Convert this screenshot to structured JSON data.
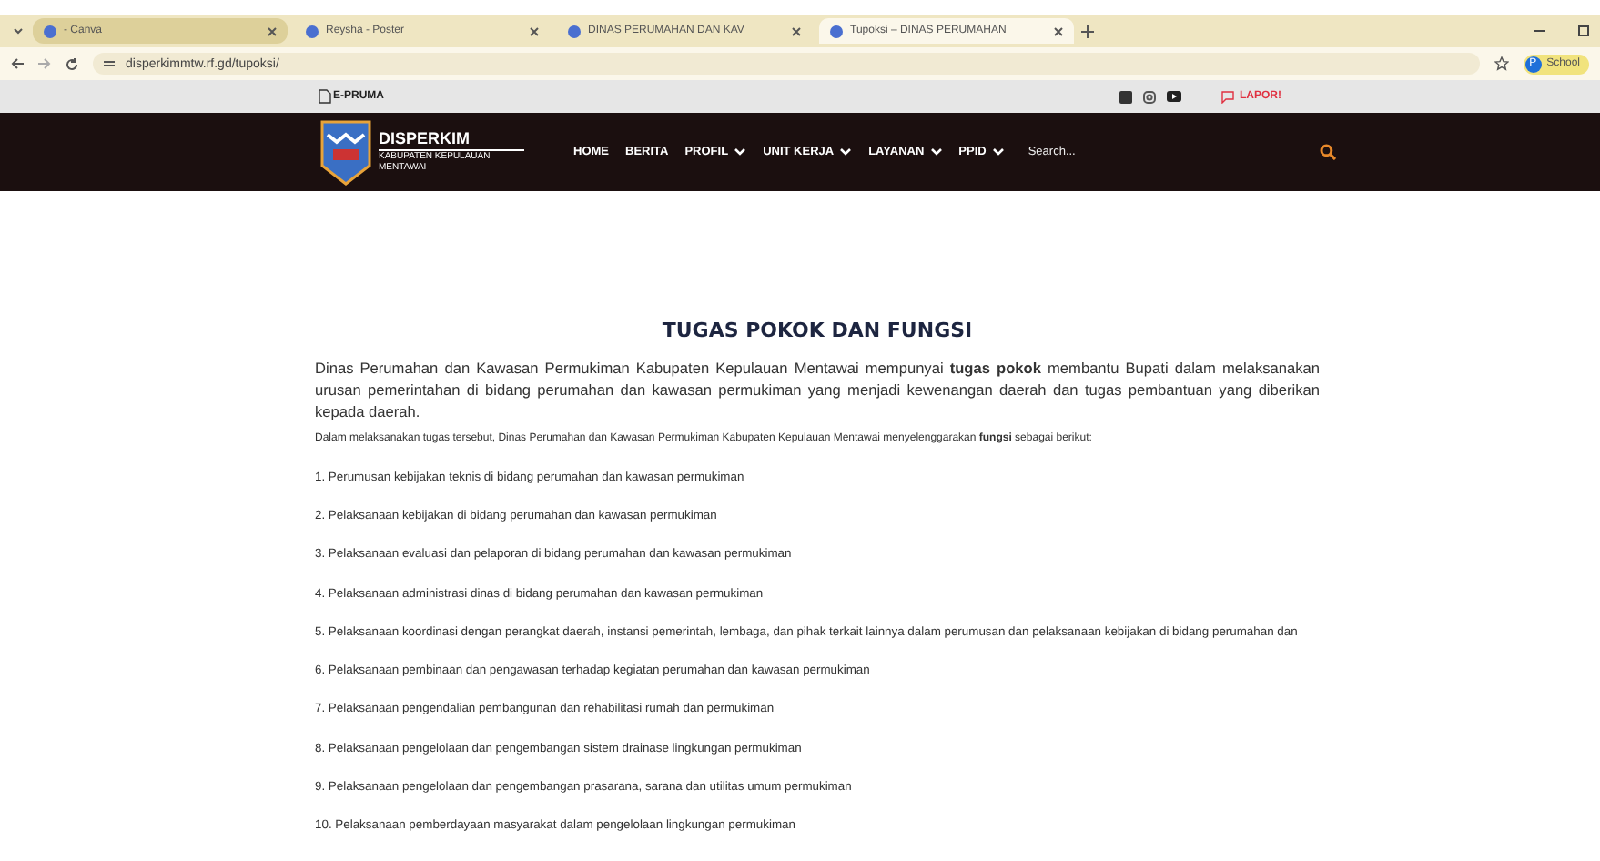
{
  "browser": {
    "tabs": [
      {
        "label": "- Canva",
        "selected": false,
        "hovered": true
      },
      {
        "label": "Reysha - Poster",
        "selected": false,
        "hovered": false
      },
      {
        "label": "DINAS PERUMAHAN DAN KAV",
        "selected": false,
        "hovered": false
      },
      {
        "label": "Tupoksi – DINAS PERUMAHAN",
        "selected": true,
        "hovered": false
      }
    ],
    "url": "disperkimmtw.rf.gd/tupoksi/",
    "profile": {
      "initial": "P",
      "label": "School"
    }
  },
  "topbar": {
    "brand": "E-PRUMA",
    "report": "LAPOR!"
  },
  "nav": {
    "logo_title": "DISPERKIM",
    "logo_subtitle": "KABUPATEN KEPULAUAN MENTAWAI",
    "items": [
      {
        "label": "HOME",
        "dropdown": false
      },
      {
        "label": "BERITA",
        "dropdown": false
      },
      {
        "label": "PROFIL",
        "dropdown": true
      },
      {
        "label": "UNIT KERJA",
        "dropdown": true
      },
      {
        "label": "LAYANAN",
        "dropdown": true
      },
      {
        "label": "PPID",
        "dropdown": true
      }
    ],
    "search": {
      "placeholder": "Search..."
    }
  },
  "content": {
    "title": "TUGAS POKOK DAN FUNGSI",
    "intro": "Dinas Perumahan dan Kawasan Permukiman Kabupaten Kepulauan Mentawai mempunyai **tugas pokok** membantu Bupati dalam melaksanakan urusan pemerintahan di bidang perumahan dan kawasan permukiman yang menjadi kewenangan daerah dan tugas pembantuan yang diberikan kepada daerah.",
    "lead": "Dalam melaksanakan tugas tersebut, Dinas Perumahan dan Kawasan Permukiman Kabupaten Kepulauan Mentawai menyelenggarakan **fungsi** sebagai berikut:",
    "items": [
      "1. Perumusan kebijakan teknis di bidang perumahan dan kawasan permukiman",
      "2. Pelaksanaan kebijakan di bidang perumahan dan kawasan permukiman",
      "3. Pelaksanaan evaluasi dan pelaporan di bidang perumahan dan kawasan permukiman",
      "4. Pelaksanaan administrasi dinas di bidang perumahan dan kawasan permukiman",
      "5. Pelaksanaan koordinasi dengan perangkat daerah, instansi pemerintah, lembaga, dan pihak terkait lainnya dalam perumusan dan pelaksanaan kebijakan di bidang perumahan dan",
      "6. Pelaksanaan pembinaan dan pengawasan terhadap kegiatan perumahan dan kawasan permukiman",
      "7. Pelaksanaan pengendalian pembangunan dan rehabilitasi rumah dan permukiman",
      "8. Pelaksanaan pengelolaan dan pengembangan sistem drainase lingkungan permukiman",
      "9. Pelaksanaan pengelolaan dan pengembangan prasarana, sarana dan utilitas umum permukiman",
      "10. Pelaksanaan pemberdayaan masyarakat dalam pengelolaan lingkungan permukiman"
    ]
  }
}
